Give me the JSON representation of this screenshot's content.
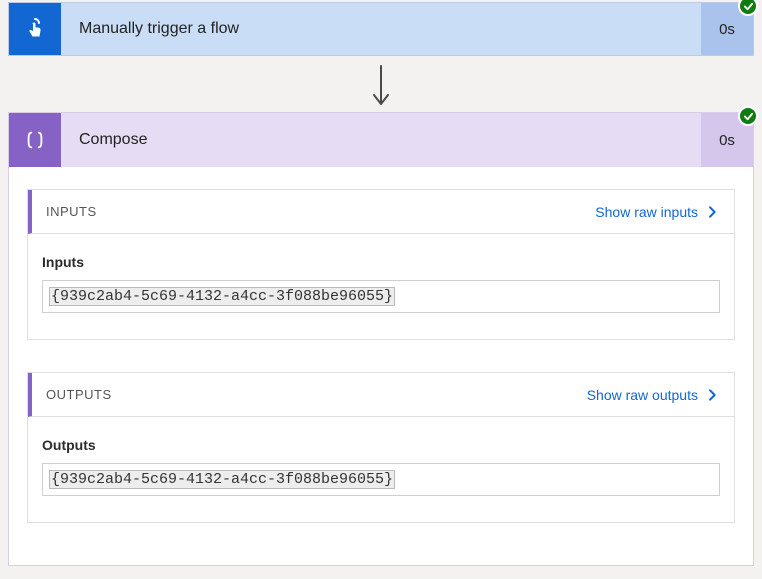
{
  "trigger": {
    "title": "Manually trigger a flow",
    "time": "0s"
  },
  "compose": {
    "title": "Compose",
    "time": "0s",
    "inputs": {
      "header": "INPUTS",
      "show_raw": "Show raw inputs",
      "label": "Inputs",
      "value": "{939c2ab4-5c69-4132-a4cc-3f088be96055}"
    },
    "outputs": {
      "header": "OUTPUTS",
      "show_raw": "Show raw outputs",
      "label": "Outputs",
      "value": "{939c2ab4-5c69-4132-a4cc-3f088be96055}"
    }
  }
}
